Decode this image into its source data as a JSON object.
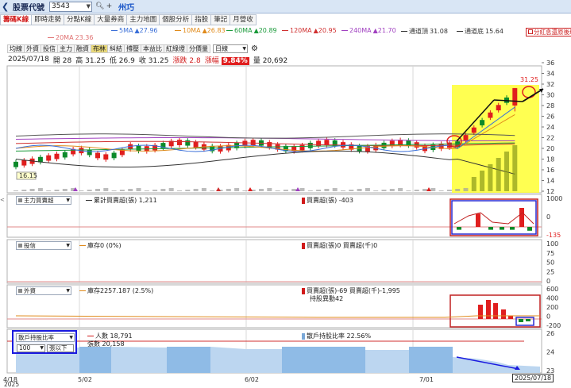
{
  "topbar": {
    "back_icon": "chevron-left-icon",
    "title": "股票代號",
    "code_value": "3543",
    "stock_name": "州巧"
  },
  "tabs": [
    "籌碼K線",
    "即時走勢",
    "分點K線",
    "大量券商",
    "主力地圖",
    "個股分析",
    "指股",
    "筆記",
    "月營收"
  ],
  "active_tab": 0,
  "ma": [
    {
      "label": "20MA",
      "value": "23.36",
      "color": "#e07070"
    },
    {
      "label": "5MA",
      "value": "▲27.96",
      "color": "#3a6fd8"
    },
    {
      "label": "10MA",
      "value": "▲26.83",
      "color": "#e08a1a"
    },
    {
      "label": "60MA",
      "value": "▲20.89",
      "color": "#1a9a3a"
    },
    {
      "label": "120MA",
      "value": "▲20.95",
      "color": "#d03030"
    },
    {
      "label": "240MA",
      "value": "▲21.70",
      "color": "#a040c0"
    },
    {
      "label": "通道頂",
      "value": "31.08",
      "color": "#333333"
    },
    {
      "label": "通道底",
      "value": "15.64",
      "color": "#333333"
    }
  ],
  "ma_button": "分紅息還原後均線",
  "chart_tools": [
    "均線",
    "外資",
    "投信",
    "主力",
    "融資",
    "布林",
    "糾結",
    "撐壓",
    "本益比",
    "紅綠燈",
    "分價量"
  ],
  "active_tool": 5,
  "period": "日線",
  "ohlc": {
    "date": "2025/07/18",
    "open_label": "開",
    "open": "28",
    "high_label": "高",
    "high": "31.25",
    "low_label": "低",
    "low": "26.9",
    "close_label": "收",
    "close": "31.25",
    "change_label": "漲跌",
    "change": "2.8",
    "pct_label": "漲幅",
    "pct": "9.84%",
    "vol_label": "量",
    "vol": "20,692"
  },
  "price_axis": [
    "36",
    "34",
    "32",
    "30",
    "28",
    "26",
    "24",
    "22",
    "20",
    "18",
    "16",
    "14",
    "12"
  ],
  "price_marks": {
    "high": "31.25",
    "low": "16.15"
  },
  "panel1": {
    "selector": "主力買賣超",
    "legend1": "累計買賣超(張) 1,211",
    "legend2": "買賣超(張) -403",
    "axis": [
      "1000",
      "0",
      "-135"
    ]
  },
  "panel2": {
    "selector": "投信",
    "legend1": "庫存0 (0%)",
    "legend2": "買賣超(張)0 買賣超(千)0",
    "axis": [
      "100",
      "75",
      "50",
      "25",
      "0"
    ]
  },
  "panel3": {
    "selector": "外資",
    "legend1": "庫存2257.187 (2.5%)",
    "legend2": "買賣超(張)-69 買賣超(千)-1,995",
    "legend3": "持股異動42",
    "axis": [
      "600",
      "400",
      "200",
      "0",
      "-200"
    ]
  },
  "panel4": {
    "selector": "散戶持股比率",
    "threshold": "100",
    "threshold_suffix": "張以下",
    "legend1": "人數 18,791",
    "legend2": "張數 20,158",
    "legend3": "散戶持股比率 22.56%",
    "axis": [
      "26",
      "24",
      "23"
    ]
  },
  "x_axis": [
    "4/18",
    "5/02",
    "6/02",
    "7/01"
  ],
  "x_year": "2025",
  "date_tag": "2025/07/18"
}
